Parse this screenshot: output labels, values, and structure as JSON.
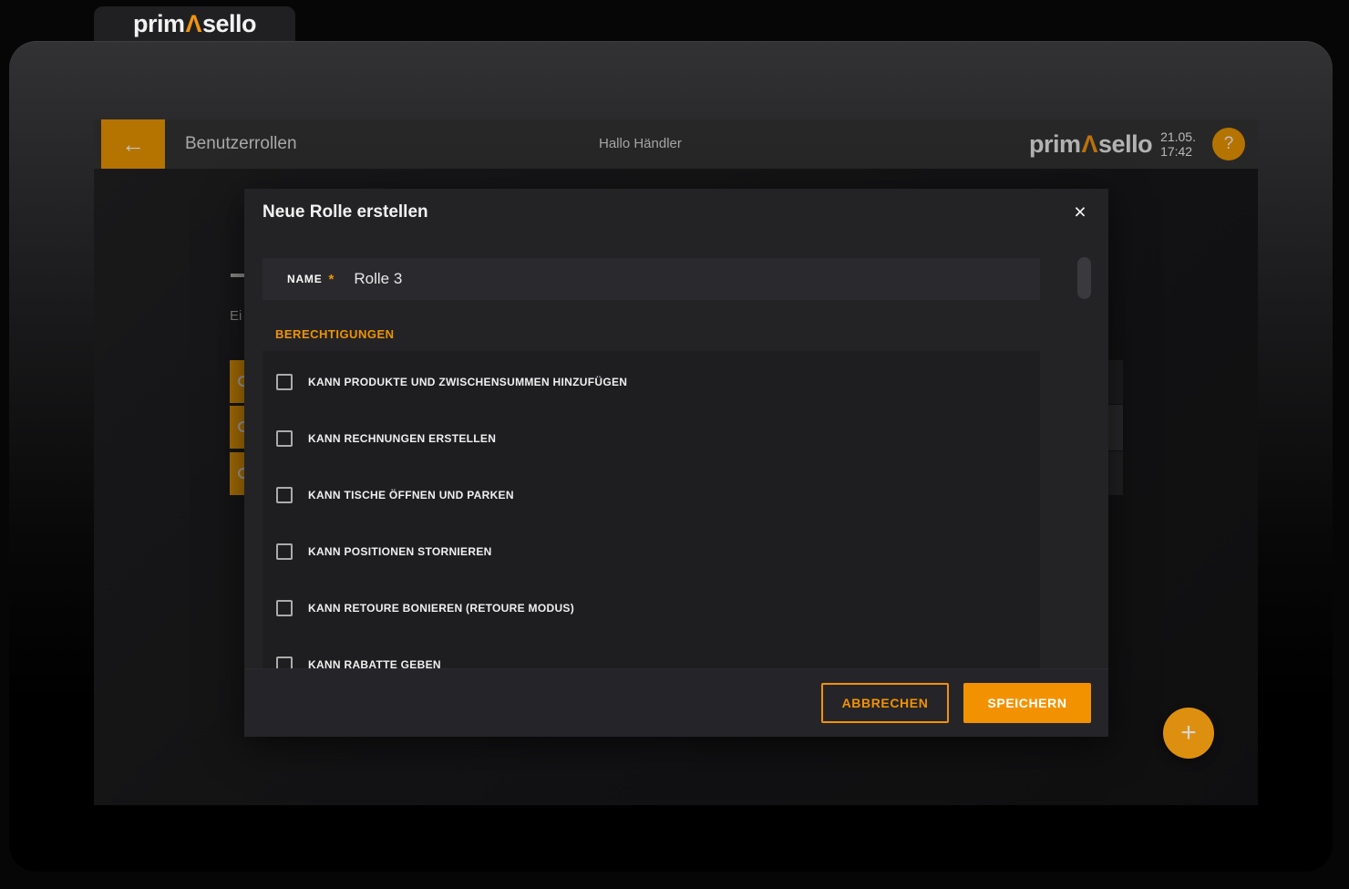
{
  "colors": {
    "accent": "#f39200",
    "accent_dim": "#e89400",
    "modal_bg": "#232326",
    "screen_bg": "#1a1a1c",
    "header_bg": "#28282a"
  },
  "browser_tab": {
    "logo_part1": "prim",
    "logo_accent": "Λ",
    "logo_part2": "sello"
  },
  "header": {
    "back_glyph": "←",
    "title": "Benutzerrollen",
    "greeting": "Hallo Händler",
    "logo_part1": "prim",
    "logo_accent": "Λ",
    "logo_part2": "sello",
    "date": "21.05.",
    "time": "17:42",
    "help_glyph": "?"
  },
  "background_page": {
    "clipped_text": "Ei"
  },
  "modal": {
    "title": "Neue Rolle erstellen",
    "close_glyph": "×",
    "name_field": {
      "label": "NAME",
      "required_mark": "*",
      "value": "Rolle 3"
    },
    "permissions_heading": "BERECHTIGUNGEN",
    "permissions": [
      {
        "label": "KANN PRODUKTE UND ZWISCHENSUMMEN HINZUFÜGEN",
        "checked": false
      },
      {
        "label": "KANN RECHNUNGEN ERSTELLEN",
        "checked": false
      },
      {
        "label": "KANN TISCHE ÖFFNEN UND PARKEN",
        "checked": false
      },
      {
        "label": "KANN POSITIONEN STORNIEREN",
        "checked": false
      },
      {
        "label": "KANN RETOURE BONIEREN (RETOURE MODUS)",
        "checked": false
      },
      {
        "label": "KANN RABATTE GEBEN",
        "checked": false
      }
    ],
    "cancel_label": "ABBRECHEN",
    "save_label": "SPEICHERN"
  },
  "fab": {
    "glyph": "+"
  }
}
